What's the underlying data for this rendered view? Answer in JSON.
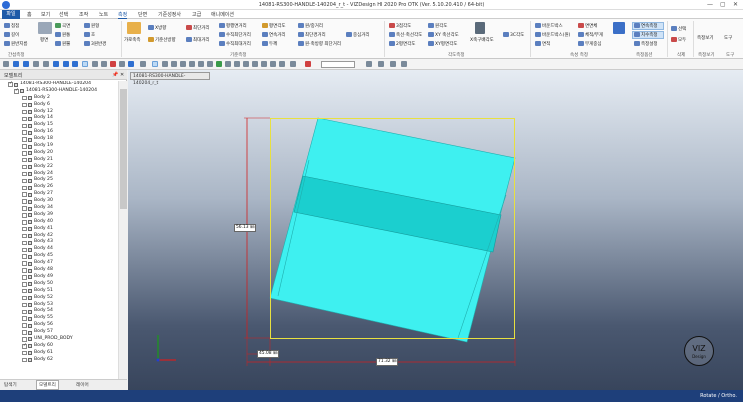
{
  "window": {
    "title": "14081-RS300-HANDLE-140204_r_t - VIZDesign HI 2020 Pro OTK (Ver. 5.10.20.410 / 64-bit)",
    "min": "—",
    "max": "▢",
    "close": "✕"
  },
  "menu": [
    "파일",
    "홈",
    "보기",
    "선택",
    "조작",
    "노트",
    "측정",
    "단면",
    "기준성정사",
    "고급",
    "애니메이션"
  ],
  "ribbon": {
    "groups": [
      "간섭측정",
      "기준측정",
      "각도측정",
      "속성 측정",
      "측정옵션",
      "삭제",
      "측정보기",
      "도구"
    ],
    "buttons": {
      "b1": "점점",
      "b2": "길이",
      "b3": "원반지름",
      "b4": "평면",
      "b5": "곡면",
      "b6": "원통",
      "b7": "원뿔",
      "b8": "원형",
      "b9": "호",
      "b10": "3원반경",
      "b11": "가로축측",
      "b12": "X방향",
      "b13": "기준선방향",
      "b14": "최단거리",
      "b15": "최대거리",
      "b16": "평행면거리",
      "b17": "수직최단거리",
      "b18": "수직최대거리",
      "b19": "평면각도",
      "b20": "연속거리",
      "b21": "두께",
      "b22": "원/중거리",
      "b23": "최단경거리",
      "b24": "원·축방향 최단거리",
      "b25": "중심거리",
      "b26": "3점각도",
      "b27": "축선·축선각도",
      "b28": "2평면각도",
      "b29": "원각도",
      "b30": "XY 축선각도",
      "b31": "XY평면각도",
      "b32": "X축구배각도",
      "b33": "3C각도",
      "b34": "바운드박스",
      "b35": "바운드박스(원)",
      "b36": "면적",
      "b37": "면면체",
      "b38": "체적/부게",
      "b39": "무게중심",
      "b40": "연속측정",
      "b41": "치수측정",
      "b42": "측정설정",
      "b43": "선택",
      "b44": "모두",
      "b45": "측정보기",
      "b46": "도구"
    }
  },
  "toolbar": {
    "input_value": ""
  },
  "left_panel": {
    "title": "모델트리",
    "pin": "📌",
    "close": "✕",
    "root": "14081-RS300-HANDLE-140204",
    "sub": "14081-RS300-HANDLE-140204",
    "items": [
      "Body 2",
      "Body 6",
      "Body 12",
      "Body 14",
      "Body 15",
      "Body 16",
      "Body 18",
      "Body 19",
      "Body 20",
      "Body 21",
      "Body 22",
      "Body 24",
      "Body 25",
      "Body 26",
      "Body 27",
      "Body 30",
      "Body 34",
      "Body 39",
      "Body 40",
      "Body 41",
      "Body 42",
      "Body 43",
      "Body 44",
      "Body 45",
      "Body 47",
      "Body 48",
      "Body 49",
      "Body 50",
      "Body 51",
      "Body 52",
      "Body 53",
      "Body 54",
      "Body 55",
      "Body 56",
      "Body 57",
      "UNI_PROD_BODY",
      "Body 60",
      "Body 61",
      "Body 62"
    ],
    "checked_index": 36,
    "tabs": [
      "탐색기",
      "모델트리",
      "레이어"
    ]
  },
  "viewport": {
    "tab": "14081-RS300-HANDLE-140204_r_t",
    "dim_vertical": "56.13 ㎜",
    "dim_horizontal_left": "45.08 ㎜",
    "dim_horizontal": "71.32 ㎜",
    "viz_text": "VIZ",
    "viz_sub": "Design",
    "colors": {
      "body": "#3ef0f0",
      "band": "#1bcfcf",
      "bbox": "#e8e040",
      "dim": "#d02020"
    }
  },
  "status": {
    "text": "Rotate / Ortho."
  }
}
